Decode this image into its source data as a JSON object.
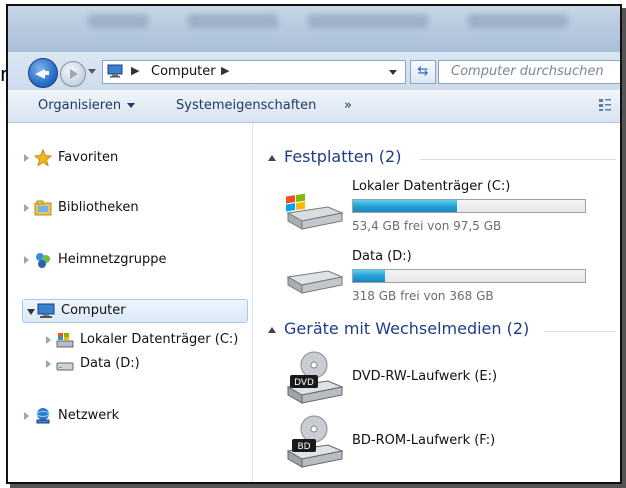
{
  "partial_text": "n",
  "address": {
    "path_segment": "Computer",
    "search_placeholder": "Computer durchsuchen"
  },
  "toolbar": {
    "organize_label": "Organisieren",
    "system_props_label": "Systemeigenschaften",
    "more_label": "»"
  },
  "nav": {
    "favorites": "Favoriten",
    "libraries": "Bibliotheken",
    "homegroup": "Heimnetzgruppe",
    "computer": "Computer",
    "local_disk": "Lokaler Datenträger (C:)",
    "data_disk": "Data (D:)",
    "network": "Netzwerk"
  },
  "content": {
    "hard_drives_header": "Festplatten (2)",
    "drives": [
      {
        "name": "Lokaler Datenträger (C:)",
        "free_text": "53,4 GB frei von 97,5 GB",
        "used_fraction": 0.45
      },
      {
        "name": "Data (D:)",
        "free_text": "318 GB frei von 368 GB",
        "used_fraction": 0.14
      }
    ],
    "removable_header": "Geräte mit Wechselmedien (2)",
    "removable": [
      {
        "name": "DVD-RW-Laufwerk (E:)",
        "badge": "DVD"
      },
      {
        "name": "BD-ROM-Laufwerk (F:)",
        "badge": "BD"
      }
    ]
  },
  "colors": {
    "accent": "#1e3c8a",
    "bar_fill": "#26a0d6"
  }
}
